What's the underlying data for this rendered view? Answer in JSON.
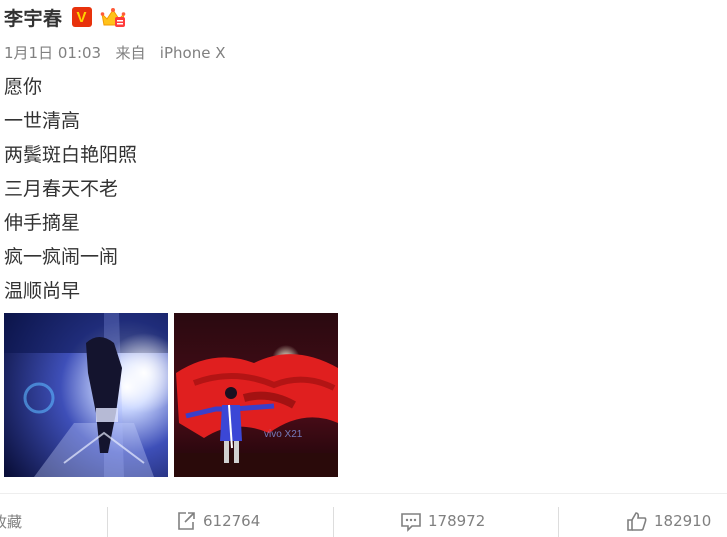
{
  "user": {
    "name": "李宇春",
    "verified_badge": "V"
  },
  "meta": {
    "date": "1月1日 01:03",
    "source_prefix": "来自",
    "device": "iPhone X"
  },
  "post_lines": [
    "愿你",
    "一世清高",
    "两鬓斑白艳阳照",
    "三月春天不老",
    "伸手摘星",
    "疯一疯闹一闹",
    "温顺尚早"
  ],
  "photo2_text": "vivo X21",
  "actions": {
    "favorite_label": "收藏",
    "repost_count": "612764",
    "comment_count": "178972",
    "like_count": "182910"
  },
  "icons": {
    "verified": "verified-v-icon",
    "crown": "crown-icon",
    "repost": "repost-icon",
    "comment": "comment-icon",
    "like": "like-icon"
  },
  "colors": {
    "badge_red": "#e8320c",
    "badge_yellow": "#ffd400",
    "meta_gray": "#808080"
  }
}
